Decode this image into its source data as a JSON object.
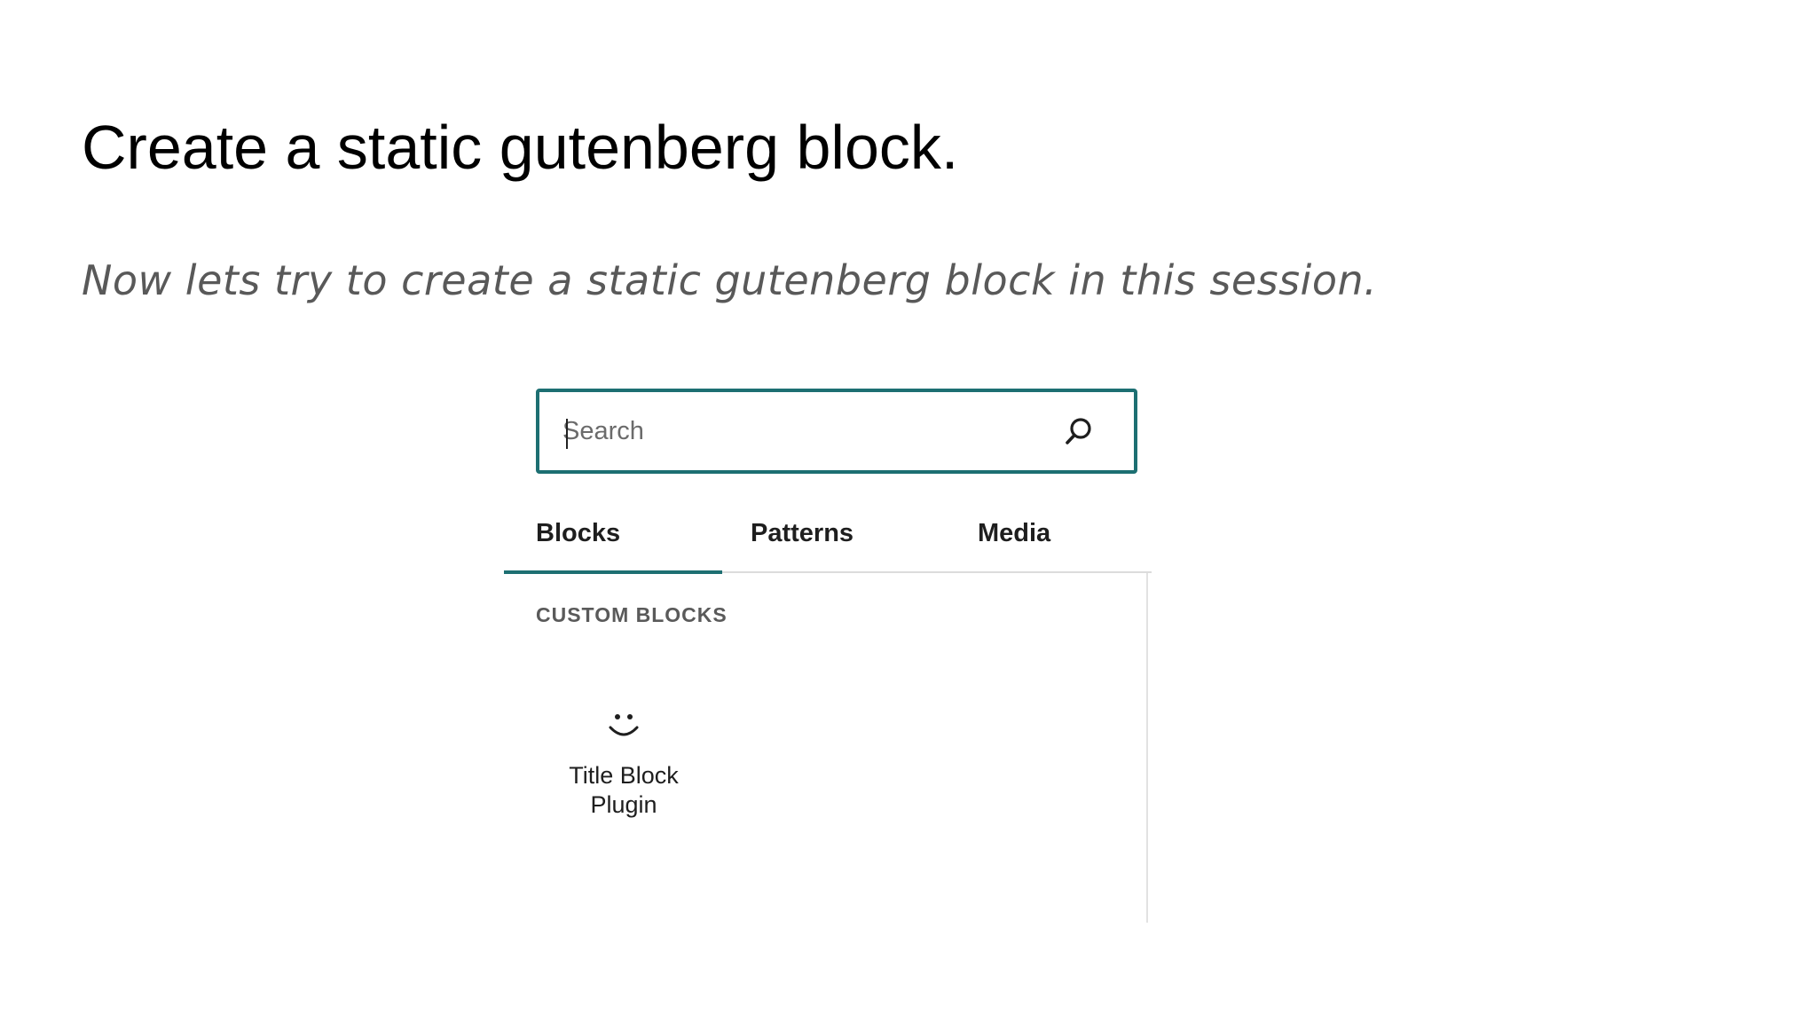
{
  "slide": {
    "title": "Create a static gutenberg block.",
    "subtitle": "Now lets try to create a static gutenberg block in this session."
  },
  "inserter": {
    "search": {
      "placeholder": "Search",
      "value": "",
      "icon": "search-icon"
    },
    "tabs": [
      {
        "label": "Blocks",
        "active": true
      },
      {
        "label": "Patterns",
        "active": false
      },
      {
        "label": "Media",
        "active": false
      }
    ],
    "category": {
      "heading": "CUSTOM BLOCKS",
      "blocks": [
        {
          "label": "Title Block Plugin",
          "icon": "smiley-icon"
        }
      ]
    },
    "accent_color": "#1d6f72"
  }
}
